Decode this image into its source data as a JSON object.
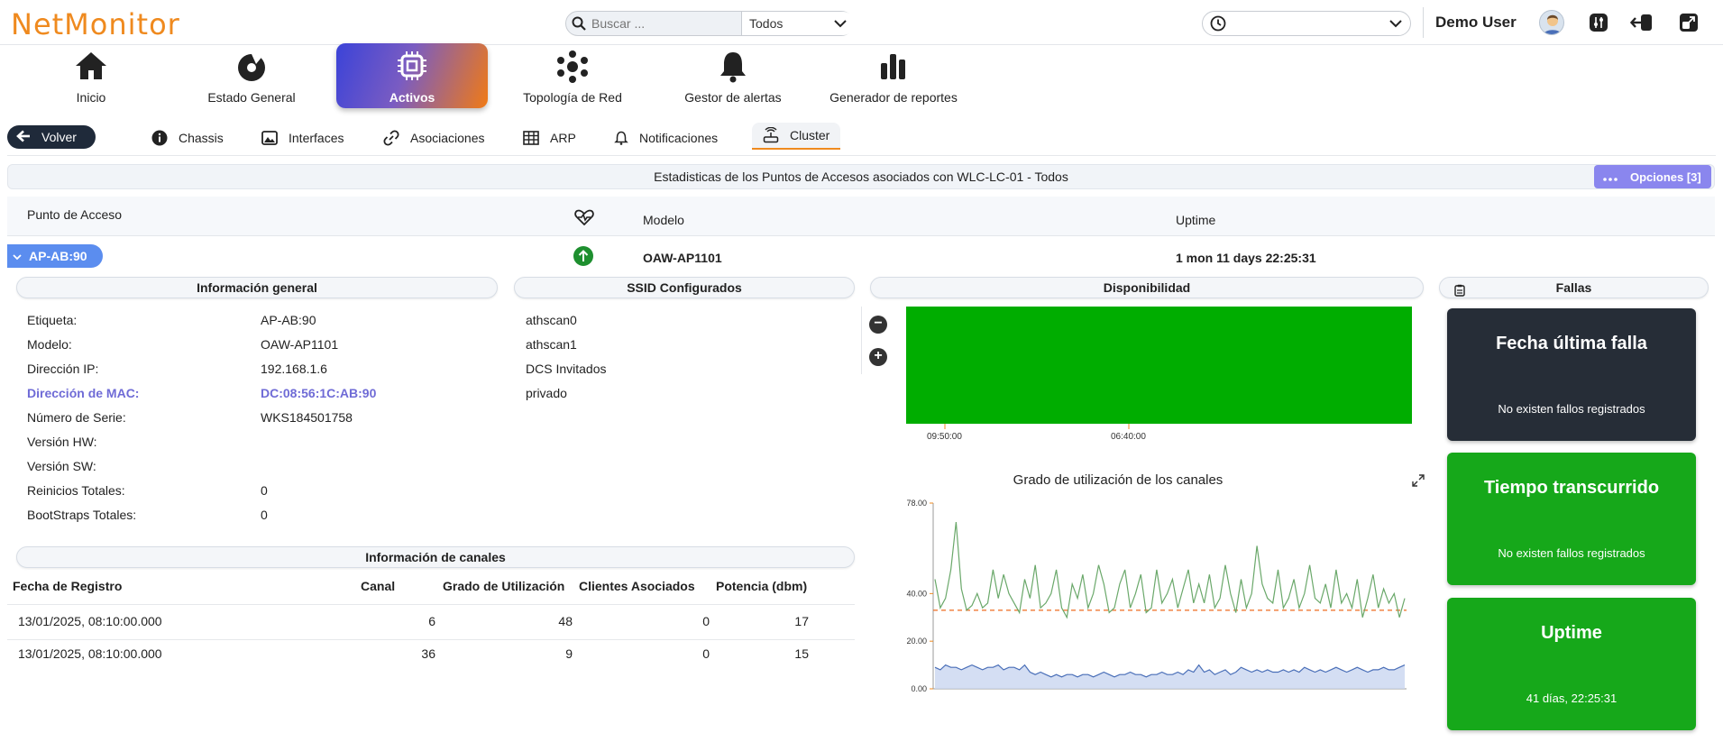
{
  "app": {
    "logo": "NetMonitor",
    "search_placeholder": "Buscar ...",
    "search_scope": "Todos",
    "user_name": "Demo User"
  },
  "nav": [
    {
      "label": "Inicio",
      "icon": "home-icon"
    },
    {
      "label": "Estado General",
      "icon": "gauge-icon"
    },
    {
      "label": "Activos",
      "icon": "chip-icon",
      "active": true
    },
    {
      "label": "Topología de Red",
      "icon": "network-icon"
    },
    {
      "label": "Gestor de alertas",
      "icon": "bell-icon"
    },
    {
      "label": "Generador de reportes",
      "icon": "bar-chart-icon"
    }
  ],
  "subnav": {
    "back": "Volver",
    "tabs": [
      "Chassis",
      "Interfaces",
      "Asociaciones",
      "ARP",
      "Notificaciones",
      "Cluster"
    ],
    "active_tab": "Cluster"
  },
  "section": {
    "title": "Estadisticas de los Puntos de Accesos asociados con WLC-LC-01 - Todos",
    "options_label": "Opciones [3]"
  },
  "table": {
    "headers": [
      "Punto de Acceso",
      "Modelo",
      "Uptime"
    ],
    "row": {
      "ap": "AP-AB:90",
      "model": "OAW-AP1101",
      "uptime": "1 mon 11 days 22:25:31",
      "status": "up"
    }
  },
  "general_info": {
    "title": "Información general",
    "items": [
      {
        "label": "Etiqueta:",
        "value": "AP-AB:90"
      },
      {
        "label": "Modelo:",
        "value": "OAW-AP1101"
      },
      {
        "label": "Dirección IP:",
        "value": "192.168.1.6"
      },
      {
        "label": "Dirección de MAC:",
        "value": "DC:08:56:1C:AB:90",
        "highlight": true
      },
      {
        "label": "Número de Serie:",
        "value": "WKS184501758"
      },
      {
        "label": "Versión HW:",
        "value": ""
      },
      {
        "label": "Versión SW:",
        "value": ""
      },
      {
        "label": "Reinicios Totales:",
        "value": "0"
      },
      {
        "label": "BootStraps Totales:",
        "value": "0"
      }
    ]
  },
  "ssid": {
    "title": "SSID Configurados",
    "items": [
      "athscan0",
      "athscan1",
      "DCS Invitados",
      "privado"
    ]
  },
  "channels": {
    "title": "Información de canales",
    "headers": [
      "Fecha de Registro",
      "Canal",
      "Grado de Utilización",
      "Clientes Asociados",
      "Potencia (dbm)"
    ],
    "rows": [
      [
        "13/01/2025, 08:10:00.000",
        "6",
        "48",
        "0",
        "17"
      ],
      [
        "13/01/2025, 08:10:00.000",
        "36",
        "9",
        "0",
        "15"
      ]
    ]
  },
  "availability": {
    "title": "Disponibilidad",
    "ticks": [
      "09:50:00",
      "06:40:00"
    ],
    "color": "#00ad00"
  },
  "chart_data": {
    "type": "line",
    "title": "Grado de utilización de los canales",
    "ylim": [
      0,
      78
    ],
    "yticks": [
      "0.00",
      "20.00",
      "40.00",
      "78.00"
    ],
    "threshold": 33,
    "series": [
      {
        "color": "#6aa86a",
        "values": [
          46,
          34,
          38,
          50,
          70,
          42,
          33,
          35,
          40,
          34,
          36,
          50,
          38,
          48,
          40,
          36,
          32,
          46,
          38,
          52,
          34,
          36,
          40,
          50,
          34,
          30,
          44,
          38,
          48,
          34,
          40,
          52,
          44,
          32,
          34,
          44,
          50,
          34,
          40,
          48,
          32,
          34,
          50,
          36,
          40,
          46,
          34,
          42,
          50,
          36,
          44,
          36,
          48,
          34,
          38,
          52,
          40,
          32,
          46,
          34,
          40,
          60,
          44,
          38,
          36,
          50,
          34,
          38,
          46,
          34,
          40,
          52,
          38,
          36,
          44,
          34,
          50,
          36,
          40,
          34,
          46,
          30,
          38,
          48,
          34,
          42,
          36,
          40,
          30,
          38
        ]
      },
      {
        "color": "#4a6fb8",
        "values": [
          9,
          8,
          10,
          9,
          9,
          8,
          9,
          10,
          9,
          8,
          9,
          9,
          10,
          8,
          9,
          9,
          8,
          10,
          7,
          6,
          7,
          6,
          5,
          6,
          5,
          6,
          6,
          5,
          6,
          6,
          5,
          6,
          7,
          6,
          5,
          6,
          6,
          7,
          6,
          6,
          5,
          6,
          6,
          7,
          6,
          6,
          7,
          6,
          8,
          7,
          10,
          7,
          8,
          6,
          7,
          8,
          6,
          7,
          9,
          8,
          7,
          8,
          7,
          8,
          7,
          7,
          8,
          7,
          8,
          7,
          9,
          8,
          7,
          8,
          7,
          8,
          9,
          8,
          7,
          8,
          9,
          8,
          7,
          8,
          8,
          9,
          8,
          8,
          9,
          10
        ]
      }
    ]
  },
  "fallas": {
    "title": "Fallas",
    "cards": [
      {
        "title": "Fecha última falla",
        "text": "No existen fallos registrados",
        "style": "dark"
      },
      {
        "title": "Tiempo transcurrido",
        "text": "No existen fallos registrados",
        "style": "green"
      },
      {
        "title": "Uptime",
        "text": "41 días, 22:25:31",
        "style": "green"
      }
    ]
  }
}
